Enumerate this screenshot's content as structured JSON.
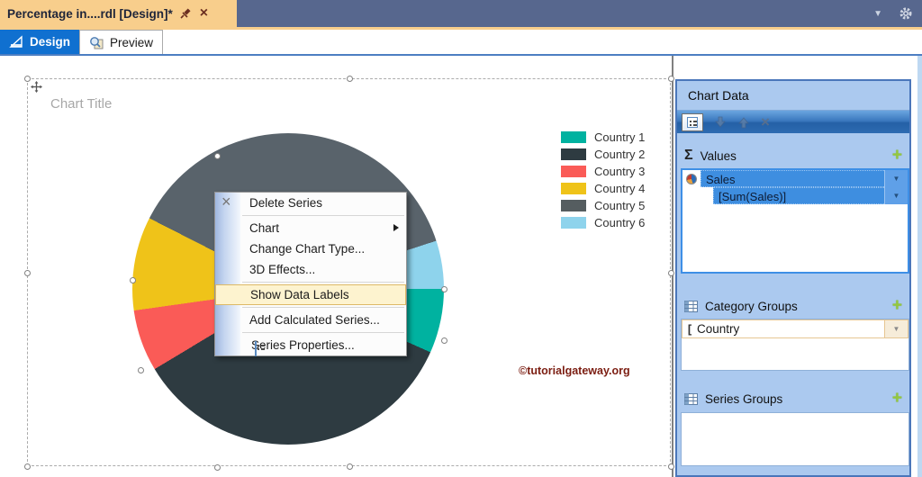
{
  "window": {
    "doc_tab_title": "Percentage in....rdl [Design]*",
    "view_tabs": [
      {
        "label": "Design",
        "active": true
      },
      {
        "label": "Preview",
        "active": false
      }
    ]
  },
  "design_surface": {
    "chart_title": "Chart Title",
    "watermark": "©tutorialgateway.org"
  },
  "chart_data": {
    "type": "pie",
    "title": "Chart Title",
    "legend_position": "right",
    "categories": [
      "Country 1",
      "Country 2",
      "Country 3",
      "Country 4",
      "Country 5",
      "Country 6"
    ],
    "values_percent": [
      6.7,
      34.7,
      6.4,
      9.7,
      37.5,
      5.0
    ],
    "colors": [
      "#00B2A0",
      "#2E3B41",
      "#FA5B57",
      "#EFC319",
      "#59636B",
      "#8ED3EC"
    ],
    "slices": [
      {
        "name": "Country 5",
        "color": "#59636B",
        "from": 0,
        "to": 72
      },
      {
        "name": "Country 6",
        "color": "#8ED3EC",
        "from": 72,
        "to": 90
      },
      {
        "name": "Country 1",
        "color": "#00B2A0",
        "from": 90,
        "to": 114
      },
      {
        "name": "Country 2",
        "color": "#2E3B41",
        "from": 114,
        "to": 239
      },
      {
        "name": "Country 3",
        "color": "#FA5B57",
        "from": 239,
        "to": 262
      },
      {
        "name": "Country 4",
        "color": "#EFC319",
        "from": 262,
        "to": 297
      },
      {
        "name": "Country 5",
        "color": "#59636B",
        "from": 297,
        "to": 360
      }
    ]
  },
  "legend": {
    "items": [
      {
        "label": "Country 1",
        "color": "#00B2A0"
      },
      {
        "label": "Country 2",
        "color": "#2E3B41"
      },
      {
        "label": "Country 3",
        "color": "#FA5B57"
      },
      {
        "label": "Country 4",
        "color": "#EFC319"
      },
      {
        "label": "Country 5",
        "color": "#555D60"
      },
      {
        "label": "Country 6",
        "color": "#8ED3EC"
      }
    ]
  },
  "context_menu": {
    "items": [
      {
        "label": "Delete Series",
        "icon": "delete-x-icon"
      },
      {
        "label": "Chart",
        "has_submenu": true
      },
      {
        "label": "Change Chart Type..."
      },
      {
        "label": "3D Effects..."
      },
      {
        "label": "Show Data Labels",
        "highlighted": true
      },
      {
        "label": "Add Calculated Series..."
      },
      {
        "label": "Series Properties...",
        "icon": "properties-icon"
      }
    ],
    "highlight_color": "#FDF3CF"
  },
  "chart_data_panel": {
    "title": "Chart Data",
    "toolbar": [
      "properties",
      "move-down",
      "move-up",
      "delete"
    ],
    "values": {
      "header": "Values",
      "sigma": "Σ",
      "add_label": "+",
      "rows": [
        {
          "label": "Sales",
          "icon": "pie"
        },
        {
          "label": "[Sum(Sales)]",
          "indent": true
        }
      ]
    },
    "category_groups": {
      "header": "Category Groups",
      "add_label": "+",
      "rows": [
        {
          "label": "Country",
          "prefix": "["
        }
      ]
    },
    "series_groups": {
      "header": "Series Groups",
      "add_label": "+",
      "rows": []
    }
  },
  "ui_colors": {
    "topbar": "#57678E",
    "doc_tab": "#F8CE8C",
    "active_tab_blue": "#1070D0",
    "panel_bg": "#ABC9EF",
    "row_highlight_blue": "#3E8EE0"
  }
}
